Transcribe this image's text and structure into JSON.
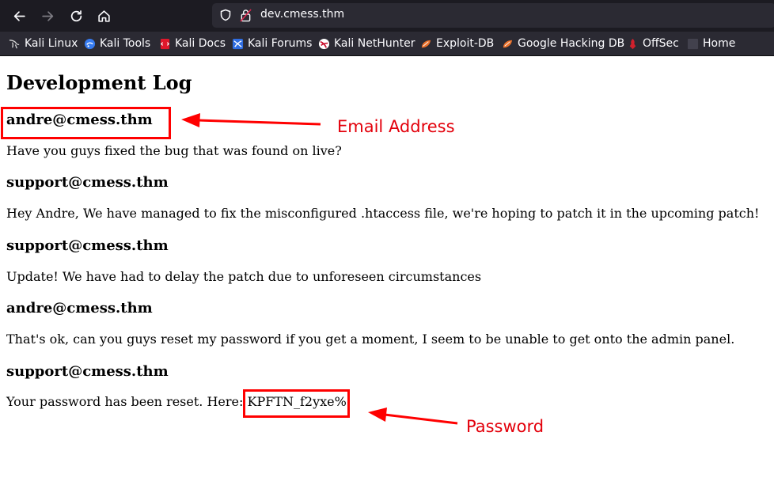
{
  "browser": {
    "url": "dev.cmess.thm",
    "bookmarks": [
      {
        "label": "Kali Linux",
        "icon": "kali-dragon-icon"
      },
      {
        "label": "Kali Tools",
        "icon": "kali-tools-icon"
      },
      {
        "label": "Kali Docs",
        "icon": "kali-docs-icon"
      },
      {
        "label": "Kali Forums",
        "icon": "kali-forums-icon"
      },
      {
        "label": "Kali NetHunter",
        "icon": "kali-nethunter-icon"
      },
      {
        "label": "Exploit-DB",
        "icon": "exploit-db-icon"
      },
      {
        "label": "Google Hacking DB",
        "icon": "ghdb-icon"
      },
      {
        "label": "OffSec",
        "icon": "offsec-icon"
      },
      {
        "label": "Home",
        "icon": "folder-icon"
      }
    ]
  },
  "page": {
    "title": "Development Log",
    "entries": [
      {
        "sender": "andre@cmess.thm",
        "message": "Have you guys fixed the bug that was found on live?"
      },
      {
        "sender": "support@cmess.thm",
        "message": "Hey Andre, We have managed to fix the misconfigured .htaccess file, we're hoping to patch it in the upcoming patch!"
      },
      {
        "sender": "support@cmess.thm",
        "message": "Update! We have had to delay the patch due to unforeseen circumstances"
      },
      {
        "sender": "andre@cmess.thm",
        "message": "That's ok, can you guys reset my password if you get a moment, I seem to be unable to get onto the admin panel."
      },
      {
        "sender": "support@cmess.thm",
        "message_prefix": "Your password has been reset. Here: ",
        "password": "KPFTN_f2yxe%"
      }
    ]
  },
  "annotations": {
    "email_label": "Email Address",
    "password_label": "Password",
    "color": "#ff0000"
  }
}
